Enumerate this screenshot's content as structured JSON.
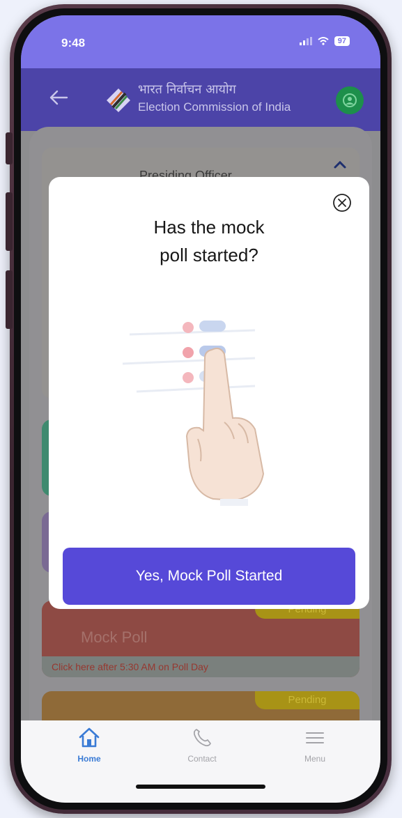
{
  "status_bar": {
    "time": "9:48",
    "battery": "97"
  },
  "app_bar": {
    "title_hindi": "भारत निर्वाचन आयोग",
    "title_english": "Election Commission of India"
  },
  "background": {
    "officer_card_title": "Presiding Officer",
    "pending_label": "Pending",
    "mock_poll_title": "Mock Poll",
    "mock_poll_subtitle": "Click here after 5:30 AM on Poll Day"
  },
  "modal": {
    "question_line1": "Has the mock",
    "question_line2": "poll started?",
    "confirm_label": "Yes, Mock Poll Started"
  },
  "bottom_nav": {
    "items": [
      {
        "label": "Home",
        "icon": "home-icon"
      },
      {
        "label": "Contact",
        "icon": "phone-icon"
      },
      {
        "label": "Menu",
        "icon": "menu-icon"
      }
    ]
  },
  "colors": {
    "status_bar": "#7b73e8",
    "app_bar": "#4c44a8",
    "primary_button": "#5649d8",
    "home_active": "#3a7bd5",
    "mock_poll_card": "#8e4a44",
    "pending_badge": "#a89316"
  }
}
